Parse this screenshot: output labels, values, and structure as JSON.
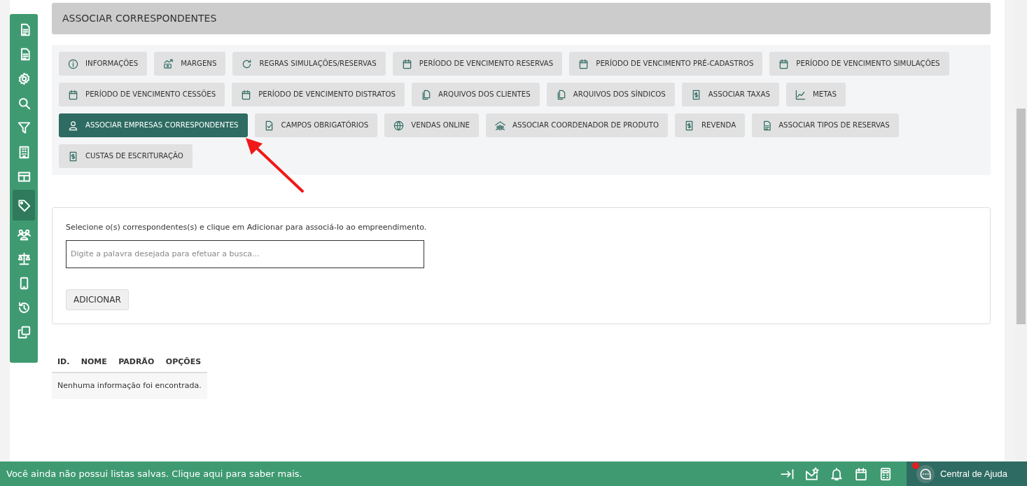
{
  "sidebar": {
    "items": [
      {
        "kind": "document",
        "selected": false
      },
      {
        "kind": "document",
        "selected": false
      },
      {
        "kind": "gear",
        "selected": false
      },
      {
        "kind": "search",
        "selected": false
      },
      {
        "kind": "filter",
        "selected": false
      },
      {
        "kind": "building",
        "selected": false
      },
      {
        "kind": "table",
        "selected": false
      },
      {
        "kind": "tag",
        "selected": true
      },
      {
        "kind": "people",
        "selected": false
      },
      {
        "kind": "scale",
        "selected": false
      },
      {
        "kind": "phone",
        "selected": false
      },
      {
        "kind": "history",
        "selected": false
      },
      {
        "kind": "copy",
        "selected": false
      }
    ]
  },
  "title": "ASSOCIAR CORRESPONDENTES",
  "tabs": [
    {
      "label": "INFORMAÇÕES",
      "kind": "info",
      "selected": false
    },
    {
      "label": "MARGENS",
      "kind": "money",
      "selected": false
    },
    {
      "label": "REGRAS SIMULAÇÕES/RESERVAS",
      "kind": "refresh",
      "selected": false
    },
    {
      "label": "PERÍODO DE VENCIMENTO RESERVAS",
      "kind": "calendar",
      "selected": false
    },
    {
      "label": "PERÍODO DE VENCIMENTO PRÉ-CADASTROS",
      "kind": "calendar",
      "selected": false
    },
    {
      "label": "PERÍODO DE VENCIMENTO SIMULAÇÕES",
      "kind": "calendar",
      "selected": false
    },
    {
      "label": "PERÍODO DE VENCIMENTO CESSÕES",
      "kind": "calendar",
      "selected": false
    },
    {
      "label": "PERÍODO DE VENCIMENTO DISTRATOS",
      "kind": "calendar",
      "selected": false
    },
    {
      "label": "ARQUIVOS DOS CLIENTES",
      "kind": "files",
      "selected": false
    },
    {
      "label": "ARQUIVOS DOS SÍNDICOS",
      "kind": "files",
      "selected": false
    },
    {
      "label": "ASSOCIAR TAXAS",
      "kind": "receipt",
      "selected": false
    },
    {
      "label": "METAS",
      "kind": "chart",
      "selected": false
    },
    {
      "label": "ASSOCIAR EMPRESAS CORRESPONDENTES",
      "kind": "user",
      "selected": true
    },
    {
      "label": "CAMPOS OBRIGATÓRIOS",
      "kind": "check-file",
      "selected": false
    },
    {
      "label": "VENDAS ONLINE",
      "kind": "globe",
      "selected": false
    },
    {
      "label": "ASSOCIAR COORDENADOR DE PRODUTO",
      "kind": "group",
      "selected": false
    },
    {
      "label": "REVENDA",
      "kind": "receipt",
      "selected": false
    },
    {
      "label": "ASSOCIAR TIPOS DE RESERVAS",
      "kind": "document",
      "selected": false
    },
    {
      "label": "CUSTAS DE ESCRITURAÇÃO",
      "kind": "receipt",
      "selected": false
    }
  ],
  "form": {
    "instruction": "Selecione o(s) correspondentes(s) e clique em Adicionar para associá-lo ao empreendimento.",
    "search": {
      "placeholder": "Digite a palavra desejada para efetuar a busca..."
    },
    "add_button": "ADICIONAR"
  },
  "table": {
    "columns": [
      "ID.",
      "NOME",
      "PADRÃO",
      "OPÇÕES"
    ],
    "empty_message": "Nenhuma informação foi encontrada."
  },
  "status_bar": {
    "message": "Você ainda não possui listas salvas. Clique aqui para saber mais.",
    "tools": [
      {
        "kind": "collapse"
      },
      {
        "kind": "mail-star"
      },
      {
        "kind": "bell"
      },
      {
        "kind": "calendar"
      },
      {
        "kind": "calculator"
      }
    ],
    "help": {
      "label": "Central de Ajuda",
      "alert": true
    }
  }
}
